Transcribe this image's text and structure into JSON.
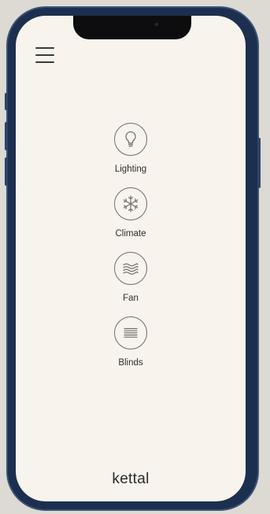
{
  "menu": {
    "icon": "hamburger-menu-icon"
  },
  "controls": [
    {
      "label": "Lighting",
      "icon": "lightbulb-icon"
    },
    {
      "label": "Climate",
      "icon": "snowflake-icon"
    },
    {
      "label": "Fan",
      "icon": "wind-waves-icon"
    },
    {
      "label": "Blinds",
      "icon": "blinds-lines-icon"
    }
  ],
  "brand": {
    "name": "kettal"
  },
  "colors": {
    "screen_background": "#f8f3ec",
    "phone_frame": "#1c2f4e",
    "icon_stroke": "#6e6e6e",
    "text": "#2e2e2e"
  }
}
